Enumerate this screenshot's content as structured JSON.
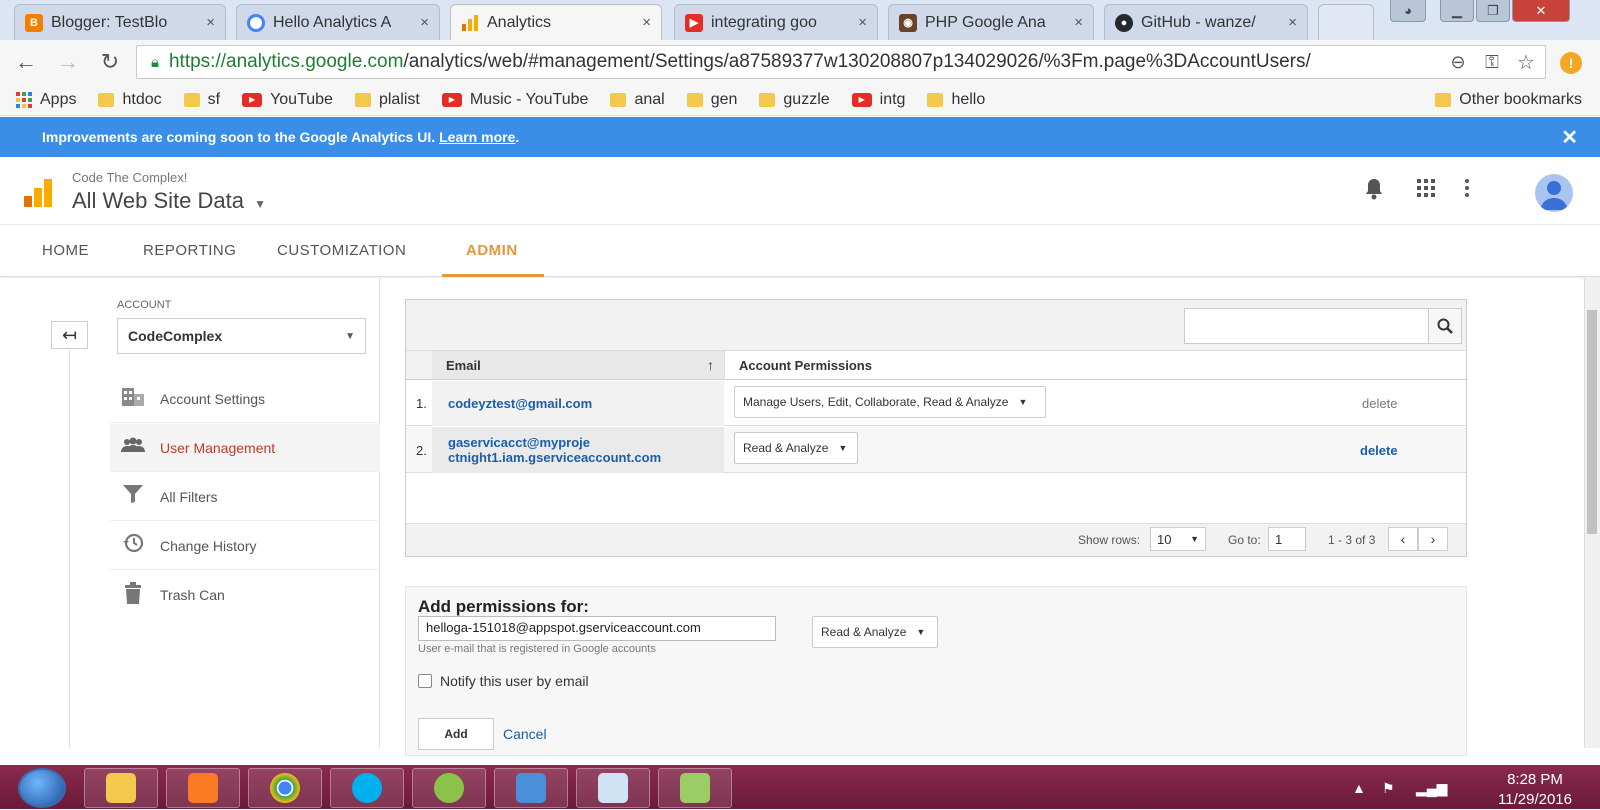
{
  "browser": {
    "tabs": [
      {
        "title": "Blogger: TestBlo",
        "icon": "blogger-icon",
        "color": "#f57d00"
      },
      {
        "title": "Hello Analytics A",
        "icon": "chrome-icon",
        "color": "#4285f4"
      },
      {
        "title": "Analytics",
        "icon": "analytics-icon",
        "color": "#f9ab00"
      },
      {
        "title": "integrating goo",
        "icon": "youtube-icon",
        "color": "#e52d27"
      },
      {
        "title": "PHP Google Ana",
        "icon": "php-icon",
        "color": "#6b4226"
      },
      {
        "title": "GitHub - wanze/",
        "icon": "github-icon",
        "color": "#24292e"
      }
    ],
    "tab_close": "×",
    "url_host": "https://analytics.google.com",
    "url_path": "/analytics/web/#management/Settings/a87589377w130208807p134029026/%3Fm.page%3DAccountUsers/",
    "bookmarks": [
      {
        "label": "Apps",
        "type": "apps"
      },
      {
        "label": "htdoc",
        "type": "folder"
      },
      {
        "label": "sf",
        "type": "folder"
      },
      {
        "label": "YouTube",
        "type": "youtube"
      },
      {
        "label": "plalist",
        "type": "folder"
      },
      {
        "label": "Music - YouTube",
        "type": "youtube"
      },
      {
        "label": "anal",
        "type": "folder"
      },
      {
        "label": "gen",
        "type": "folder"
      },
      {
        "label": "guzzle",
        "type": "folder"
      },
      {
        "label": "intg",
        "type": "youtube"
      },
      {
        "label": "hello",
        "type": "folder"
      }
    ],
    "other_bookmarks": "Other bookmarks"
  },
  "banner": {
    "text": "Improvements are coming soon to the Google Analytics UI.",
    "link": "Learn more",
    "end": ".",
    "close": "✕"
  },
  "header": {
    "account": "Code The Complex!",
    "property": "All Web Site Data"
  },
  "nav": {
    "home": "HOME",
    "reporting": "REPORTING",
    "customization": "CUSTOMIZATION",
    "admin": "ADMIN"
  },
  "sidebar": {
    "account_label": "ACCOUNT",
    "account_value": "CodeComplex",
    "items": [
      {
        "label": "Account Settings",
        "icon": "building-icon"
      },
      {
        "label": "User Management",
        "icon": "users-icon"
      },
      {
        "label": "All Filters",
        "icon": "filter-icon"
      },
      {
        "label": "Change History",
        "icon": "history-icon"
      },
      {
        "label": "Trash Can",
        "icon": "trash-icon"
      }
    ]
  },
  "table": {
    "col_email": "Email",
    "col_perms": "Account Permissions",
    "rows": [
      {
        "num": "1.",
        "email": "codeyztest@gmail.com",
        "email2": "",
        "perms": "Manage Users, Edit, Collaborate, Read & Analyze",
        "action": "delete"
      },
      {
        "num": "2.",
        "email": "gaservicacct@myproje",
        "email2": "ctnight1.iam.gserviceaccount.com",
        "perms": "Read & Analyze",
        "action": "delete"
      }
    ],
    "show_rows_label": "Show rows:",
    "show_rows_value": "10",
    "goto_label": "Go to:",
    "goto_value": "1",
    "range": "1 - 3 of 3"
  },
  "add_perms": {
    "title": "Add permissions for:",
    "email_value": "helloga-151018@appspot.gserviceaccount.com",
    "hint": "User e-mail that is registered in Google accounts",
    "permission": "Read & Analyze",
    "notify_label": "Notify this user by email",
    "add_button": "Add",
    "cancel_button": "Cancel"
  },
  "taskbar": {
    "time": "8:28 PM",
    "date": "11/29/2016"
  },
  "colors": {
    "accent": "#e5973c",
    "banner": "#3b8ee8",
    "link": "#1a5eab",
    "selected_nav": "#c0392b",
    "taskbar": "#7a2244"
  }
}
